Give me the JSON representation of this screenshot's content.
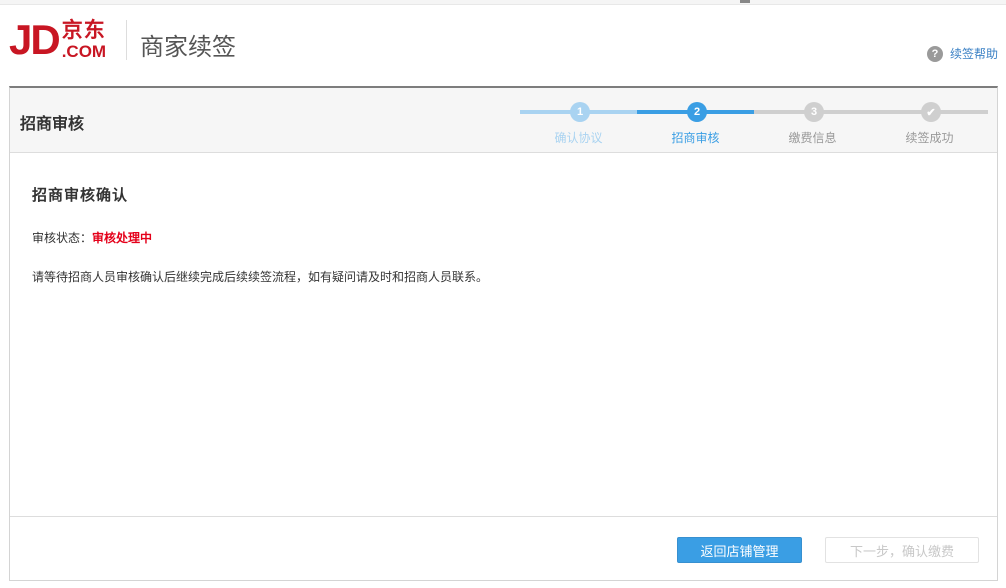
{
  "header": {
    "logo_text": "JD",
    "logo_cn": "京东",
    "logo_com": ".COM",
    "title": "商家续签",
    "help_icon": "?",
    "help_label": "续签帮助"
  },
  "panel": {
    "title": "招商审核",
    "steps": [
      {
        "num": "1",
        "label": "确认协议",
        "state": "done"
      },
      {
        "num": "2",
        "label": "招商审核",
        "state": "current"
      },
      {
        "num": "3",
        "label": "缴费信息",
        "state": "todo"
      },
      {
        "num": "✔",
        "label": "续签成功",
        "state": "todo"
      }
    ]
  },
  "content": {
    "heading": "招商审核确认",
    "status_label": "审核状态：",
    "status_value": "审核处理中",
    "notice": "请等待招商人员审核确认后继续完成后续续签流程，如有疑问请及时和招商人员联系。"
  },
  "footer": {
    "back_button": "返回店铺管理",
    "next_button": "下一步，确认缴费"
  },
  "colors": {
    "brand": "#c81623",
    "accent": "#3a9ee4",
    "status_red": "#e4001a"
  }
}
